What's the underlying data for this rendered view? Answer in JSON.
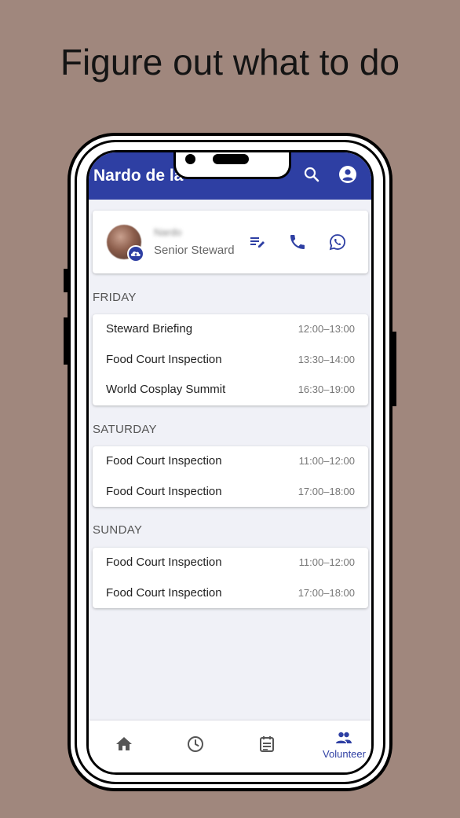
{
  "headline": "Figure out what to do",
  "app": {
    "title": "Nardo de la",
    "accent": "#2e3fa3"
  },
  "profile": {
    "name": "Nardo",
    "role": "Senior Steward"
  },
  "schedule": [
    {
      "day": "FRIDAY",
      "items": [
        {
          "title": "Steward Briefing",
          "time": "12:00–13:00"
        },
        {
          "title": "Food Court Inspection",
          "time": "13:30–14:00"
        },
        {
          "title": "World Cosplay Summit",
          "time": "16:30–19:00"
        }
      ]
    },
    {
      "day": "SATURDAY",
      "items": [
        {
          "title": "Food Court Inspection",
          "time": "11:00–12:00"
        },
        {
          "title": "Food Court Inspection",
          "time": "17:00–18:00"
        }
      ]
    },
    {
      "day": "SUNDAY",
      "items": [
        {
          "title": "Food Court Inspection",
          "time": "11:00–12:00"
        },
        {
          "title": "Food Court Inspection",
          "time": "17:00–18:00"
        }
      ]
    }
  ],
  "bottom_nav": {
    "items": [
      {
        "icon": "home-icon"
      },
      {
        "icon": "clock-icon"
      },
      {
        "icon": "calendar-icon"
      },
      {
        "icon": "people-icon",
        "label": "Volunteer"
      }
    ]
  }
}
